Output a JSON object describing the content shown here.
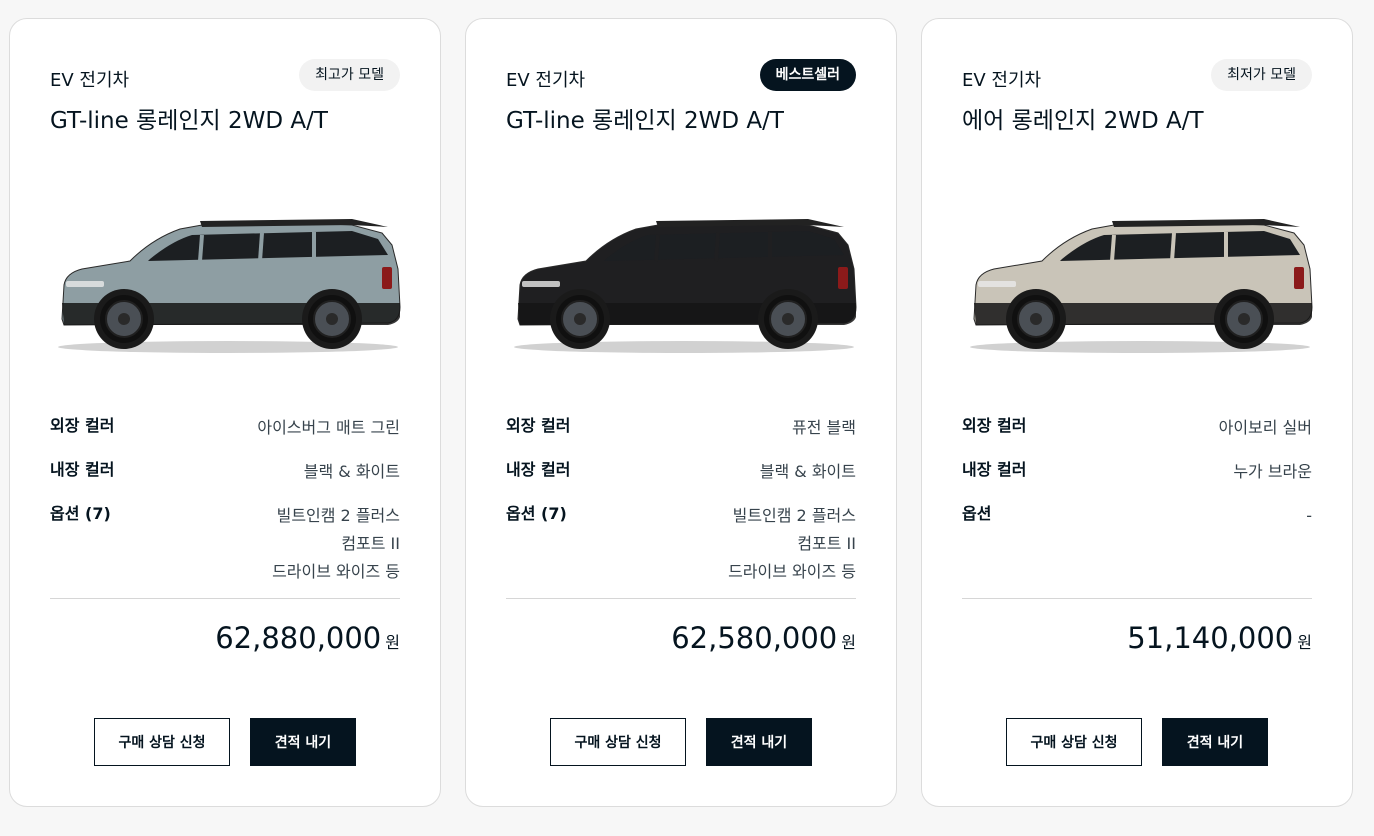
{
  "cards": [
    {
      "category": "EV 전기차",
      "badge": "최고가 모델",
      "model": "GT-line 롱레인지 2WD A/T",
      "car_color": "#8e9ea3",
      "specs": {
        "exterior_label": "외장 컬러",
        "exterior_value": "아이스버그 매트 그린",
        "interior_label": "내장 컬러",
        "interior_value": "블랙 & 화이트",
        "options_label": "옵션 (7)",
        "options_values": [
          "빌트인캠 2 플러스",
          "컴포트 II",
          "드라이브 와이즈 등"
        ]
      },
      "price": "62,880,000",
      "price_unit": "원",
      "consult_label": "구매 상담 신청",
      "quote_label": "견적 내기"
    },
    {
      "category": "EV 전기차",
      "badge": "베스트셀러",
      "model": "GT-line 롱레인지 2WD A/T",
      "car_color": "#1f1f21",
      "specs": {
        "exterior_label": "외장 컬러",
        "exterior_value": "퓨전 블랙",
        "interior_label": "내장 컬러",
        "interior_value": "블랙 & 화이트",
        "options_label": "옵션 (7)",
        "options_values": [
          "빌트인캠 2 플러스",
          "컴포트 II",
          "드라이브 와이즈 등"
        ]
      },
      "price": "62,580,000",
      "price_unit": "원",
      "consult_label": "구매 상담 신청",
      "quote_label": "견적 내기"
    },
    {
      "category": "EV 전기차",
      "badge": "최저가 모델",
      "model": "에어 롱레인지 2WD A/T",
      "car_color": "#c9c4b8",
      "specs": {
        "exterior_label": "외장 컬러",
        "exterior_value": "아이보리 실버",
        "interior_label": "내장 컬러",
        "interior_value": "누가 브라운",
        "options_label": "옵션",
        "options_values": [
          "-"
        ]
      },
      "price": "51,140,000",
      "price_unit": "원",
      "consult_label": "구매 상담 신청",
      "quote_label": "견적 내기"
    }
  ],
  "colors": {
    "primary": "#05141f",
    "background": "#f7f7f7",
    "badge_light": "#f2f2f2"
  }
}
